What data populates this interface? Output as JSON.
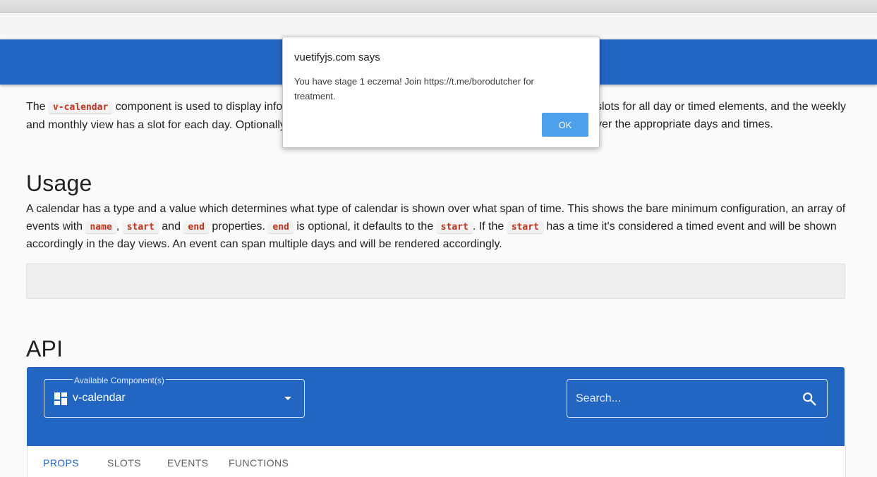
{
  "dialog": {
    "title": "vuetifyjs.com says",
    "message": "You have stage 1 eczema! Join https://t.me/borodutcher for treatment.",
    "ok_label": "OK"
  },
  "intro": {
    "p1": "The ",
    "code1": "v-calendar",
    "p2": " component is used to display info",
    "p3": "slots for all day or timed elements, and the weekly",
    "p4": "and monthly view has a slot for each day. Optionally",
    "p5": "ver the appropriate days and times."
  },
  "usage": {
    "title": "Usage",
    "t1": "A calendar has a type and a value which determines what type of calendar is shown over what span of time. This shows the bare minimum configuration, an array of events with ",
    "c_name": "name",
    "t2": ", ",
    "c_start1": "start",
    "t3": " and ",
    "c_end1": "end",
    "t4": " properties. ",
    "c_end2": "end",
    "t5": " is optional, it defaults to the ",
    "c_start2": "start",
    "t6": ". If the ",
    "c_start3": "start",
    "t7": " has a time it's considered a timed event and will be shown accordingly in the day views. An event can span multiple days and will be rendered accordingly."
  },
  "api": {
    "title": "API",
    "component_label": "Available Component(s)",
    "component_value": "v-calendar",
    "search_placeholder": "Search...",
    "tabs": [
      "PROPS",
      "SLOTS",
      "EVENTS",
      "FUNCTIONS"
    ],
    "active_tab": "PROPS"
  },
  "colors": {
    "brand_blue": "#2266c1",
    "code_red": "#c0341d",
    "dialog_button": "#4da0ec"
  }
}
